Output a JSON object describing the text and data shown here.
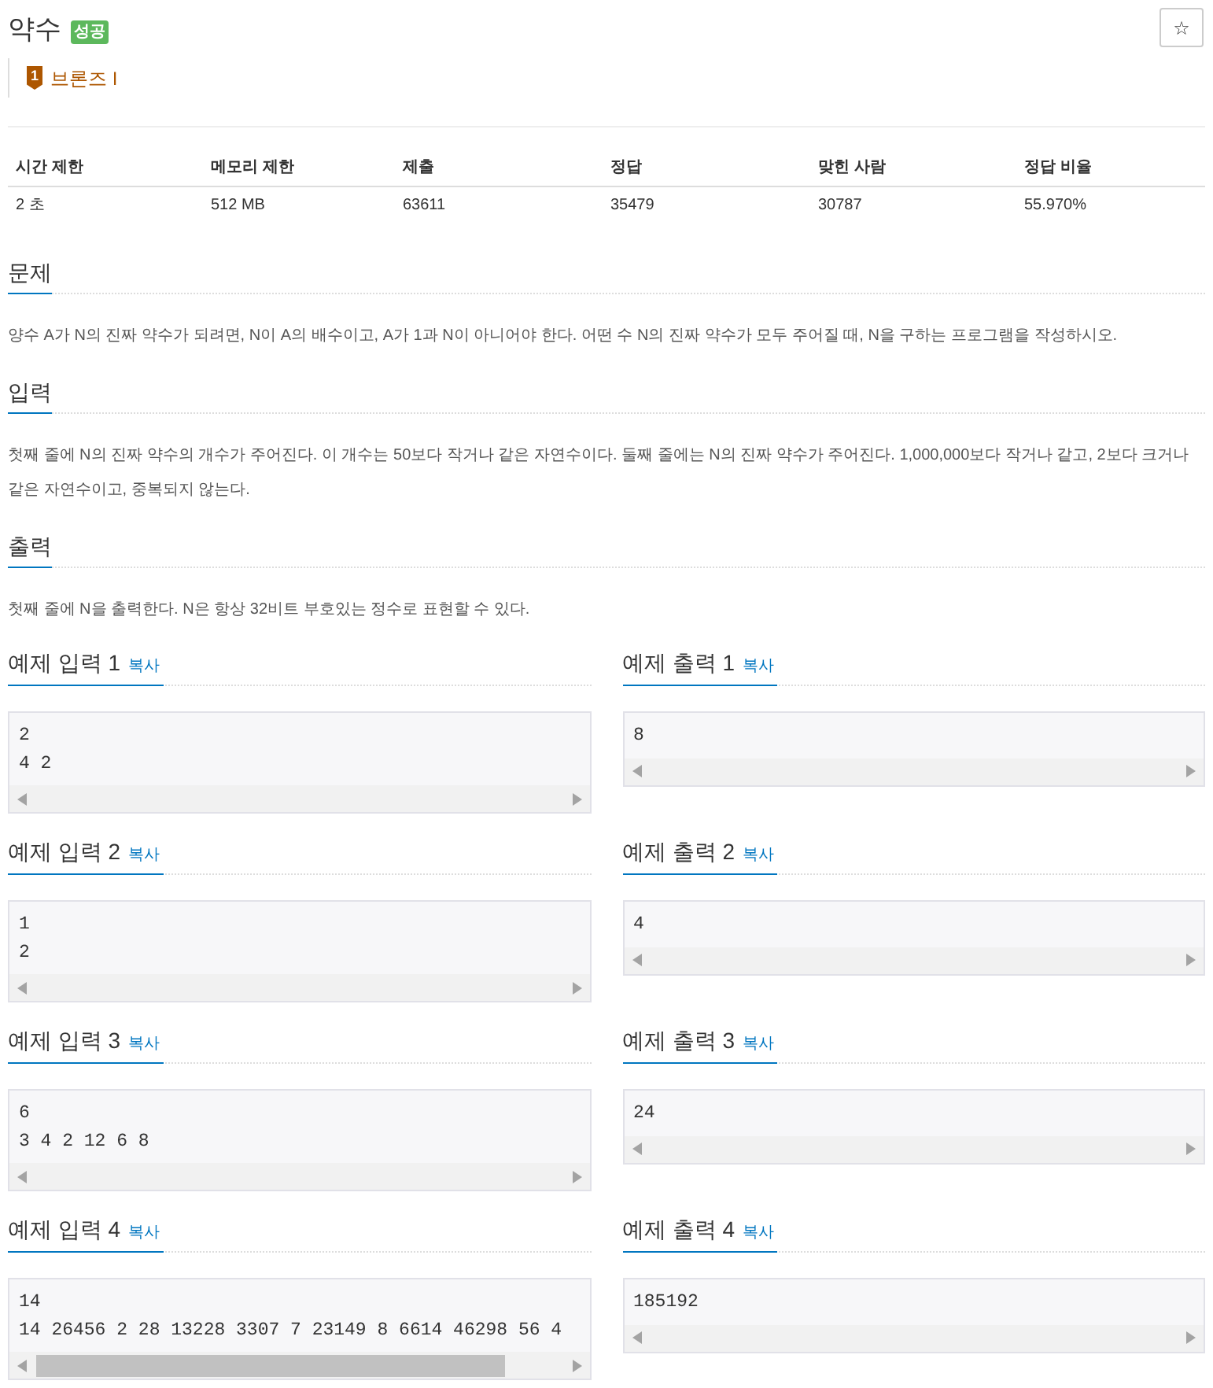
{
  "problem": {
    "title": "약수",
    "result_badge": "성공",
    "favorite_button": "☆",
    "tier": {
      "badge": "1",
      "label": "브론즈 I"
    }
  },
  "info_table": {
    "columns": [
      "시간 제한",
      "메모리 제한",
      "제출",
      "정답",
      "맞힌 사람",
      "정답 비율"
    ],
    "rows": [
      [
        "2 초",
        "512 MB",
        "63611",
        "35479",
        "30787",
        "55.970%"
      ]
    ]
  },
  "sections": [
    {
      "heading": "문제",
      "text": "양수 A가 N의 진짜 약수가 되려면, N이 A의 배수이고, A가 1과 N이 아니어야 한다. 어떤 수 N의 진짜 약수가 모두 주어질 때, N을 구하는 프로그램을 작성하시오."
    },
    {
      "heading": "입력",
      "text": "첫째 줄에 N의 진짜 약수의 개수가 주어진다. 이 개수는 50보다 작거나 같은 자연수이다. 둘째 줄에는 N의 진짜 약수가 주어진다. 1,000,000보다 작거나 같고, 2보다 크거나 같은 자연수이고, 중복되지 않는다."
    },
    {
      "heading": "출력",
      "text": "첫째 줄에 N을 출력한다. N은 항상 32비트 부호있는 정수로 표현할 수 있다."
    }
  ],
  "samples": [
    {
      "input": {
        "heading": "예제 입력 1",
        "copy_link": "복사",
        "code": "2\n4 2"
      },
      "output": {
        "heading": "예제 출력 1",
        "copy_link": "복사",
        "code": "8"
      }
    },
    {
      "input": {
        "heading": "예제 입력 2",
        "copy_link": "복사",
        "code": "1\n2"
      },
      "output": {
        "heading": "예제 출력 2",
        "copy_link": "복사",
        "code": "4"
      }
    },
    {
      "input": {
        "heading": "예제 입력 3",
        "copy_link": "복사",
        "code": "6\n3 4 2 12 6 8"
      },
      "output": {
        "heading": "예제 출력 3",
        "copy_link": "복사",
        "code": "24"
      }
    },
    {
      "input": {
        "heading": "예제 입력 4",
        "copy_link": "복사",
        "code": "14\n14 26456 2 28 13228 3307 7 23149 8 6614 46298 56 4"
      },
      "output": {
        "heading": "예제 출력 4",
        "copy_link": "복사",
        "code": "185192"
      }
    }
  ]
}
